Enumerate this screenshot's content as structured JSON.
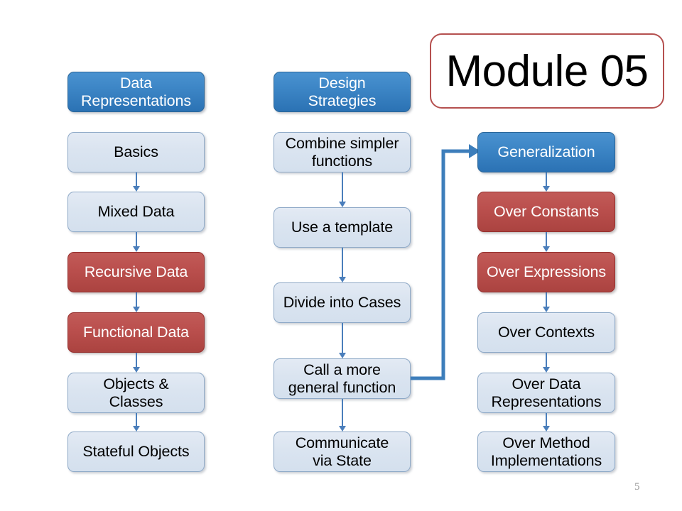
{
  "slide": {
    "title": "Module 05",
    "page_number": "5",
    "background_color": "#ffffff"
  },
  "colors": {
    "header_blue": "#2e7ebb",
    "node_light_blue": "#dce6f1",
    "node_red": "#b94a48",
    "arrow_blue": "#4a7ebb",
    "title_border_red": "#b5504f",
    "page_number_gray": "#9a9a9a"
  },
  "columns": [
    {
      "id": "data-representations",
      "header": "Data\nRepresentations",
      "header_style": "blue",
      "items": [
        {
          "label": "Basics",
          "style": "plain"
        },
        {
          "label": "Mixed Data",
          "style": "plain"
        },
        {
          "label": "Recursive Data",
          "style": "red"
        },
        {
          "label": "Functional Data",
          "style": "red"
        },
        {
          "label": "Objects &\nClasses",
          "style": "plain"
        },
        {
          "label": "Stateful Objects",
          "style": "plain"
        }
      ]
    },
    {
      "id": "design-strategies",
      "header": "Design\nStrategies",
      "header_style": "blue",
      "items": [
        {
          "label": "Combine simpler\nfunctions",
          "style": "plain"
        },
        {
          "label": "Use a template",
          "style": "plain"
        },
        {
          "label": "Divide into Cases",
          "style": "plain"
        },
        {
          "label": "Call a more\ngeneral function",
          "style": "plain"
        },
        {
          "label": "Communicate\nvia State",
          "style": "plain"
        }
      ]
    },
    {
      "id": "generalization",
      "header": null,
      "header_style": null,
      "items": [
        {
          "label": "Generalization",
          "style": "blue"
        },
        {
          "label": "Over Constants",
          "style": "red"
        },
        {
          "label": "Over Expressions",
          "style": "red"
        },
        {
          "label": "Over Contexts",
          "style": "plain"
        },
        {
          "label": "Over Data\nRepresentations",
          "style": "plain"
        },
        {
          "label": "Over Method\nImplementations",
          "style": "plain"
        }
      ]
    }
  ],
  "cross_connector": {
    "from": "Call a more general function",
    "to": "Generalization",
    "style": "elbow-arrow"
  }
}
